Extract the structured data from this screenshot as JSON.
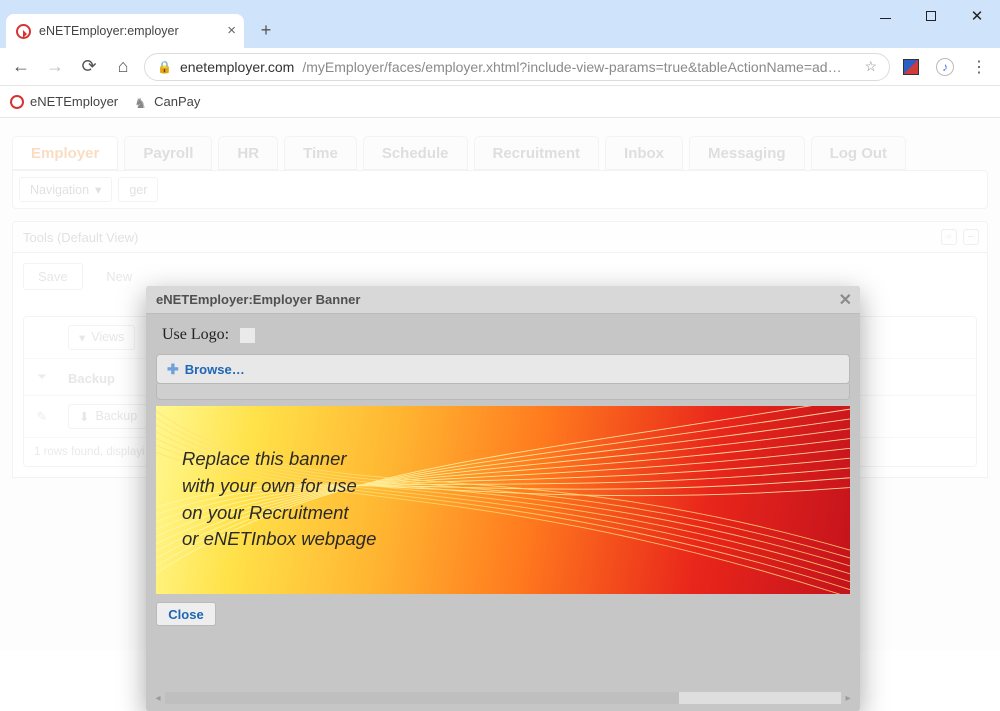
{
  "browser": {
    "tab_title": "eNETEmployer:employer",
    "url_domain": "enetemployer.com",
    "url_path": "/myEmployer/faces/employer.xhtml?include-view-params=true&tableActionName=ad…",
    "bookmarks": [
      "eNETEmployer",
      "CanPay"
    ]
  },
  "app": {
    "tabs": [
      "Employer",
      "Payroll",
      "HR",
      "Time",
      "Schedule",
      "Recruitment",
      "Inbox",
      "Messaging",
      "Log Out"
    ],
    "nav_dropdown": "Navigation",
    "field2": "ger",
    "panel_header": "Tools (Default View)",
    "save": "Save",
    "new": "New",
    "views_btn": "Views",
    "backup_label": "Backup",
    "backup_btn": "Backup",
    "footer": "1 rows found, displayi"
  },
  "modal": {
    "title": "eNETEmployer:Employer Banner",
    "use_logo": "Use Logo:",
    "browse": "Browse…",
    "banner_lines": [
      "Replace this banner",
      "with your own for use",
      "on your Recruitment",
      "or eNETInbox webpage"
    ],
    "close": "Close"
  }
}
